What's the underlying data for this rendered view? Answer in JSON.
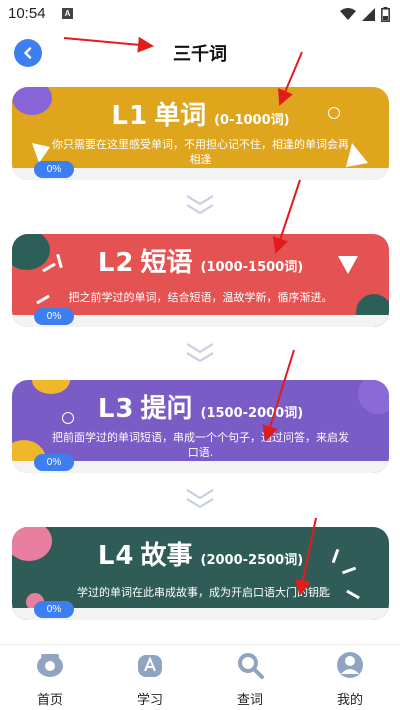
{
  "status": {
    "time": "10:54",
    "a_letter": "A"
  },
  "header": {
    "title": "三千词"
  },
  "levels": [
    {
      "level": "L1",
      "name": "单词",
      "range": "(0-1000词)",
      "desc": "你只需要在这里感受单词，不用担心记不住，相逢的单词会再相逢",
      "progress": "0%",
      "color": "#dfa51d"
    },
    {
      "level": "L2",
      "name": "短语",
      "range": "(1000-1500词)",
      "desc": "把之前学过的单词，结合短语，温故学新，循序渐进。",
      "progress": "0%",
      "color": "#e55252"
    },
    {
      "level": "L3",
      "name": "提问",
      "range": "(1500-2000词)",
      "desc": "把前面学过的单词短语，串成一个个句子，通过问答，来启发口语.",
      "progress": "0%",
      "color": "#7a5cc6"
    },
    {
      "level": "L4",
      "name": "故事",
      "range": "(2000-2500词)",
      "desc": "学过的单词在此串成故事，成为开启口语大门的钥匙",
      "progress": "0%",
      "color": "#2f5c56"
    }
  ],
  "tabs": [
    {
      "label": "首页",
      "icon": "home-icon"
    },
    {
      "label": "学习",
      "icon": "study-icon"
    },
    {
      "label": "查词",
      "icon": "search-icon"
    },
    {
      "label": "我的",
      "icon": "profile-icon"
    }
  ],
  "colors": {
    "accent": "#3d7ff0",
    "annotation": "#e21b1b",
    "tab_icon": "#8fa3c2"
  }
}
